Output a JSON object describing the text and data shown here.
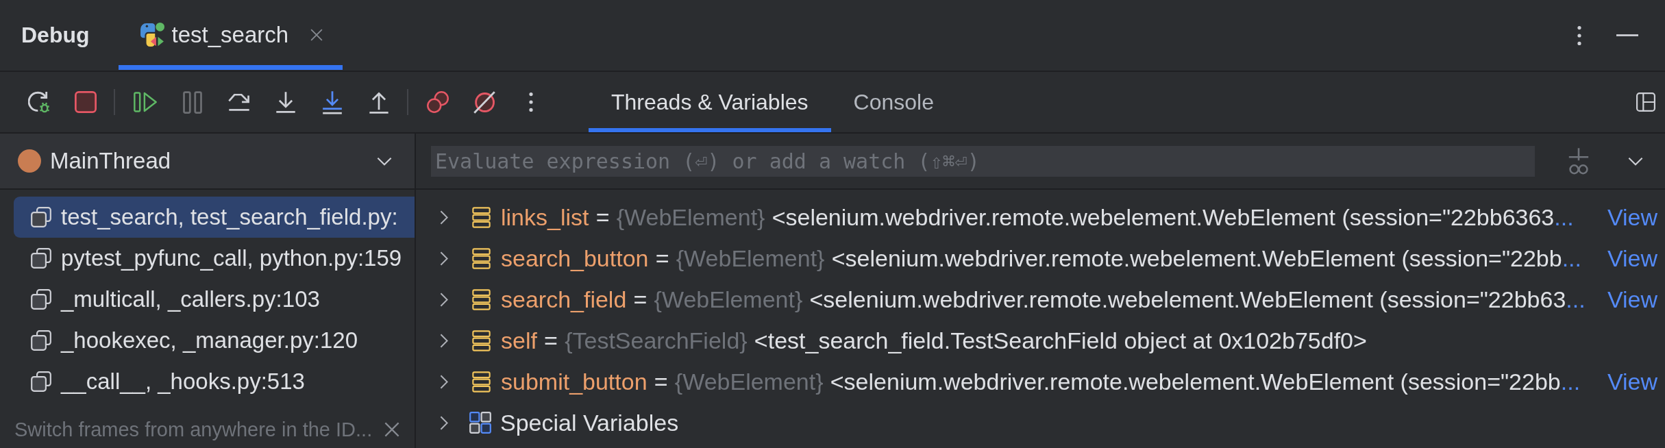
{
  "tool_window": {
    "title": "Debug",
    "tabs": [
      {
        "label": "test_search",
        "selected": true
      }
    ]
  },
  "toolbar": [
    [
      {
        "kind": "rerun",
        "disabled": false
      },
      {
        "kind": "stop",
        "disabled": false
      }
    ],
    [
      {
        "kind": "resume",
        "disabled": false
      },
      {
        "kind": "pause",
        "disabled": true
      },
      {
        "kind": "step_over",
        "disabled": false
      },
      {
        "kind": "step_into",
        "disabled": false
      },
      {
        "kind": "step_into_my_code",
        "disabled": false
      },
      {
        "kind": "step_out",
        "disabled": false
      }
    ],
    [
      {
        "kind": "view_breakpoints",
        "disabled": false
      },
      {
        "kind": "mute_breakpoints",
        "disabled": false
      },
      {
        "kind": "more",
        "disabled": false
      }
    ]
  ],
  "subtabs": [
    {
      "label": "Threads & Variables",
      "selected": true
    },
    {
      "label": "Console",
      "selected": false
    }
  ],
  "threads": {
    "current": "MainThread",
    "frames": [
      {
        "label": "test_search, test_search_field.py:",
        "selected": true
      },
      {
        "label": "pytest_pyfunc_call, python.py:159",
        "selected": false
      },
      {
        "label": "_multicall, _callers.py:103",
        "selected": false
      },
      {
        "label": "_hookexec, _manager.py:120",
        "selected": false
      },
      {
        "label": "__call__, _hooks.py:513",
        "selected": false
      }
    ],
    "hint": "Switch frames from anywhere in the ID..."
  },
  "variables": {
    "placeholder": "Evaluate expression (⏎) or add a watch (⇧⌘⏎)",
    "items": [
      {
        "kind": "field",
        "expanded": false,
        "name": "links_list",
        "operator": "=",
        "type": "{WebElement}",
        "value": "<selenium.webdriver.remote.webelement.WebElement (session=\"22bb6363",
        "ellipsis": "...",
        "link": "View"
      },
      {
        "kind": "field",
        "expanded": false,
        "name": "search_button",
        "operator": "=",
        "type": "{WebElement}",
        "value": "<selenium.webdriver.remote.webelement.WebElement (session=\"22bb",
        "ellipsis": "...",
        "link": "View"
      },
      {
        "kind": "field",
        "expanded": false,
        "name": "search_field",
        "operator": "=",
        "type": "{WebElement}",
        "value": "<selenium.webdriver.remote.webelement.WebElement (session=\"22bb63",
        "ellipsis": "...",
        "link": "View"
      },
      {
        "kind": "field",
        "expanded": false,
        "name": "self",
        "operator": "=",
        "type": "{TestSearchField}",
        "value": "<test_search_field.TestSearchField object at 0x102b75df0>"
      },
      {
        "kind": "field",
        "expanded": false,
        "name": "submit_button",
        "operator": "=",
        "type": "{WebElement}",
        "value": "<selenium.webdriver.remote.webelement.WebElement (session=\"22bb",
        "ellipsis": "...",
        "link": "View"
      },
      {
        "kind": "group",
        "expanded": false,
        "name": "Special Variables"
      }
    ]
  }
}
